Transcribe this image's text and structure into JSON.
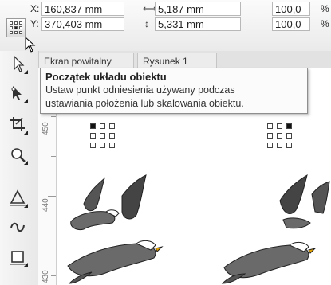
{
  "property_bar": {
    "x_label": "X:",
    "x_value": "160,837 mm",
    "y_label": "Y:",
    "y_value": "370,403 mm",
    "width_value": "5,187 mm",
    "height_value": "5,331 mm",
    "scale_x_value": "100,0",
    "scale_y_value": "100,0",
    "scale_x_unit": "%",
    "scale_y_unit": "%"
  },
  "document_tabs": [
    {
      "label": "Ekran powitalny"
    },
    {
      "label": "Rysunek 1"
    }
  ],
  "tooltip": {
    "title": "Początek układu obiektu",
    "line1": "Ustaw punkt odniesienia używany podczas",
    "line2": "ustawiania położenia lub skalowania obiektu."
  },
  "ruler": {
    "labels": [
      "450",
      "440",
      "430"
    ]
  }
}
